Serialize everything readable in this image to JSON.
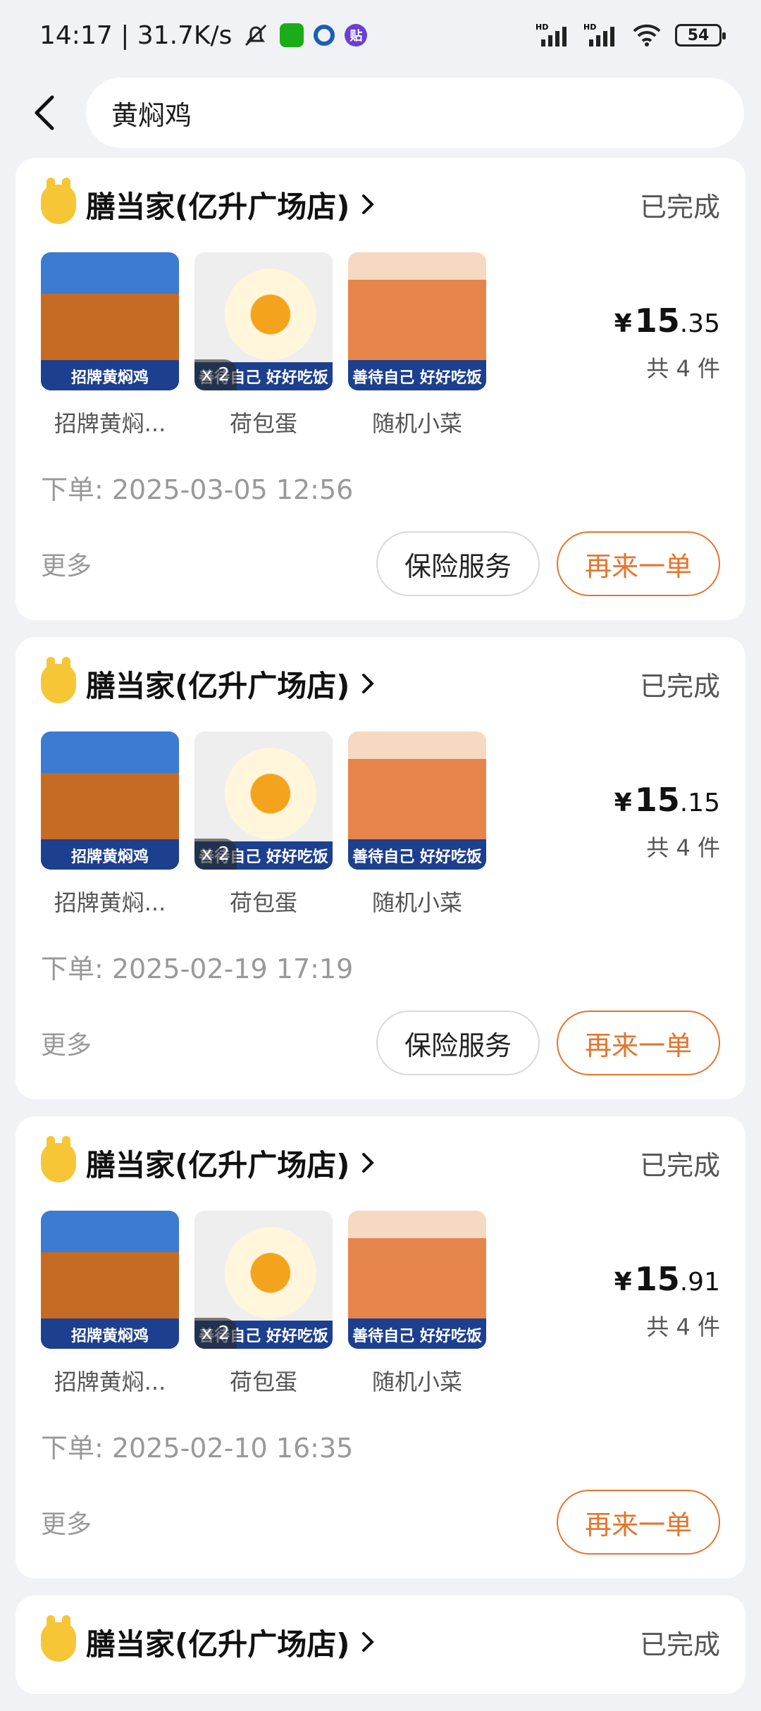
{
  "status_bar": {
    "time_speed": "14:17 | 31.7K/s",
    "battery": "54",
    "hd1": "HD",
    "hd2": "HD"
  },
  "search": {
    "query": "黄焖鸡"
  },
  "orders": [
    {
      "shop": "膳当家(亿升广场店)",
      "status": "已完成",
      "items": [
        "招牌黄焖...",
        "荷包蛋",
        "随机小菜"
      ],
      "thumb_bands": [
        "招牌黄焖鸡",
        "善待自己 好好吃饭",
        "善待自己 好好吃饭"
      ],
      "qty_badge": "x 2",
      "price_yen": "¥",
      "price_int": "15",
      "price_dec": ".35",
      "count": "共 4 件",
      "time": "下单: 2025-03-05 12:56",
      "more": "更多",
      "insurance": "保险服务",
      "reorder": "再来一单"
    },
    {
      "shop": "膳当家(亿升广场店)",
      "status": "已完成",
      "items": [
        "招牌黄焖...",
        "荷包蛋",
        "随机小菜"
      ],
      "thumb_bands": [
        "招牌黄焖鸡",
        "善待自己 好好吃饭",
        "善待自己 好好吃饭"
      ],
      "qty_badge": "x 2",
      "price_yen": "¥",
      "price_int": "15",
      "price_dec": ".15",
      "count": "共 4 件",
      "time": "下单: 2025-02-19 17:19",
      "more": "更多",
      "insurance": "保险服务",
      "reorder": "再来一单"
    },
    {
      "shop": "膳当家(亿升广场店)",
      "status": "已完成",
      "items": [
        "招牌黄焖...",
        "荷包蛋",
        "随机小菜"
      ],
      "thumb_bands": [
        "招牌黄焖鸡",
        "善待自己 好好吃饭",
        "善待自己 好好吃饭"
      ],
      "qty_badge": "x 2",
      "price_yen": "¥",
      "price_int": "15",
      "price_dec": ".91",
      "count": "共 4 件",
      "time": "下单: 2025-02-10 16:35",
      "more": "更多",
      "reorder": "再来一单"
    },
    {
      "shop": "膳当家(亿升广场店)",
      "status": "已完成"
    }
  ],
  "colors": {
    "accent": "#e2762f",
    "background": "#f1f2f6"
  }
}
